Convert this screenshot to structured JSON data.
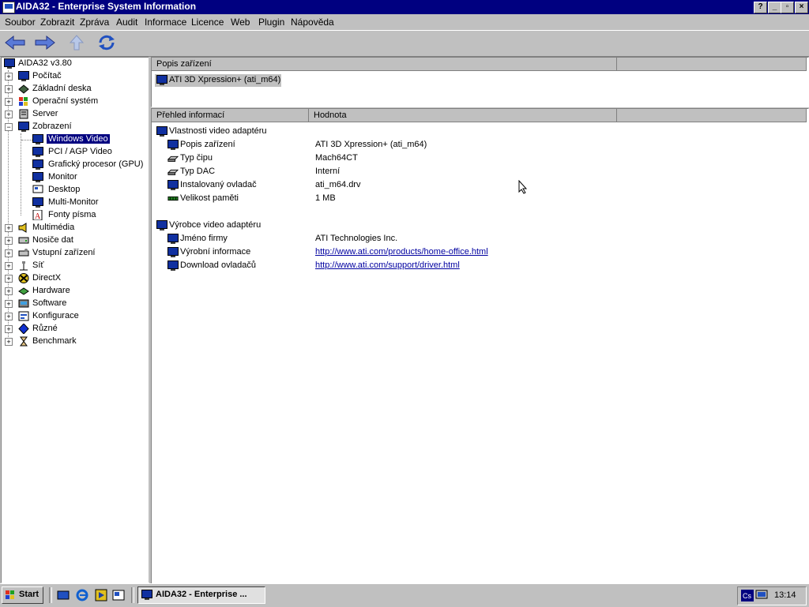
{
  "window": {
    "title": "AIDA32 - Enterprise System Information"
  },
  "menu": [
    "Soubor",
    "Zobrazit",
    "Zpráva",
    "Audit",
    "Informace",
    "Licence",
    "Web",
    "Plugin",
    "Nápověda"
  ],
  "toolbar": {
    "icons": [
      "back-arrow-icon",
      "forward-arrow-icon",
      "up-arrow-icon",
      "refresh-icon"
    ]
  },
  "tree": {
    "root": "AIDA32 v3.80",
    "items": [
      "Počítač",
      "Základní deska",
      "Operační systém",
      "Server",
      "Zobrazení",
      "Windows Video",
      "PCI / AGP Video",
      "Grafický procesor (GPU)",
      "Monitor",
      "Desktop",
      "Multi-Monitor",
      "Fonty písma",
      "Multimédia",
      "Nosiče dat",
      "Vstupní zařízení",
      "Síť",
      "DirectX",
      "Hardware",
      "Software",
      "Konfigurace",
      "Různé",
      "Benchmark"
    ],
    "selected": "Windows Video"
  },
  "device_pane": {
    "header": "Popis zařízení",
    "device": "ATI 3D Xpression+ (ati_m64)"
  },
  "detail_pane": {
    "col_field": "Přehled informací",
    "col_value": "Hodnota",
    "group1": {
      "title": "Vlastnosti video adaptéru",
      "rows": [
        {
          "field": "Popis zařízení",
          "value": "ATI 3D Xpression+ (ati_m64)"
        },
        {
          "field": "Typ čipu",
          "value": "Mach64CT"
        },
        {
          "field": "Typ DAC",
          "value": "Interní"
        },
        {
          "field": "Instalovaný ovladač",
          "value": "ati_m64.drv"
        },
        {
          "field": "Velikost paměti",
          "value": "1 MB"
        }
      ]
    },
    "group2": {
      "title": "Výrobce video adaptéru",
      "rows": [
        {
          "field": "Jméno firmy",
          "value": "ATI Technologies Inc."
        },
        {
          "field": "Výrobní informace",
          "value": "http://www.ati.com/products/home-office.html"
        },
        {
          "field": "Download ovladačů",
          "value": "http://www.ati.com/support/driver.html"
        }
      ]
    }
  },
  "taskbar": {
    "start": "Start",
    "task": "AIDA32 - Enterprise ...",
    "clock": "13:14"
  }
}
